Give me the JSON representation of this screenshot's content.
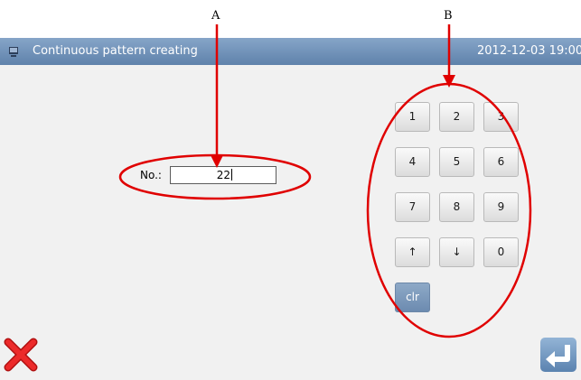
{
  "window": {
    "title": "Continuous pattern creating",
    "datetime": "2012-12-03 19:00"
  },
  "form": {
    "number_label": "No.:",
    "number_value": "22"
  },
  "keypad": {
    "keys": [
      "1",
      "2",
      "3",
      "4",
      "5",
      "6",
      "7",
      "8",
      "9",
      "↑",
      "↓",
      "0",
      "clr"
    ]
  },
  "annotations": {
    "a": "A",
    "b": "B"
  },
  "icons": {
    "app": "app-icon",
    "cancel": "close-icon",
    "enter": "enter-icon"
  },
  "colors": {
    "titlebar": "#6f90b8",
    "annotation": "#e00000",
    "cancel": "#e02020",
    "clr_key": "#7a97ba"
  }
}
